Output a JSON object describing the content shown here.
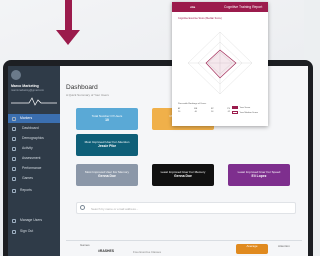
{
  "sidebar": {
    "user_name": "Marco Marketing",
    "user_email": "marcomarketing@gmail.com",
    "items": [
      {
        "label": "Markers",
        "active": true
      },
      {
        "label": "Dashboard"
      },
      {
        "label": "Demographics"
      },
      {
        "label": "Activity"
      },
      {
        "label": "Assessment"
      },
      {
        "label": "Performance"
      },
      {
        "label": "Games"
      },
      {
        "label": "Reports"
      },
      {
        "label": "Manage Users"
      },
      {
        "label": "Sign Out"
      }
    ]
  },
  "main": {
    "title": "Dashboard",
    "subtitle": "A Quick Summary of Your Users",
    "tiles": [
      {
        "label": "Total Number Of Users",
        "value": "10",
        "color": "#5aa9d6"
      },
      {
        "label": "Most Improved User",
        "value": "",
        "color": "#f0b04a"
      },
      {
        "label": "Most Improved User\nFor Attention",
        "value": "Jessie Pike",
        "color": "#0f5f78"
      },
      {
        "label": "Most Improved User\nFor Memory",
        "value": "Genna Doe",
        "color": "#8b97a8"
      },
      {
        "label": "Least Improved User\nFor Memory",
        "value": "Genna Doe",
        "color": "#111111"
      },
      {
        "label": "Least Improved User\nFor Speed",
        "value": "Eli Lopez",
        "color": "#7e2f8e"
      }
    ],
    "search_placeholder": "Search by name or email address...",
    "table": {
      "label": "Games",
      "row_name": "#RASHES",
      "row_sub": "Free Exercise Classes",
      "badge": "Average",
      "right": "Attention"
    }
  },
  "report": {
    "logo": "vita",
    "title": "Cognitive Training Report",
    "subtitle": "Cognitive Exercise Score (Median Score)",
    "table_title": "Percentile Rankings of Users",
    "table_headers": [
      "AT",
      "ME",
      "SP",
      "PS"
    ],
    "table_values": [
      "20",
      "40",
      "34",
      "62"
    ],
    "legend": [
      "Your Score",
      "Your Median Score"
    ],
    "accent": "#9b1b4c"
  }
}
